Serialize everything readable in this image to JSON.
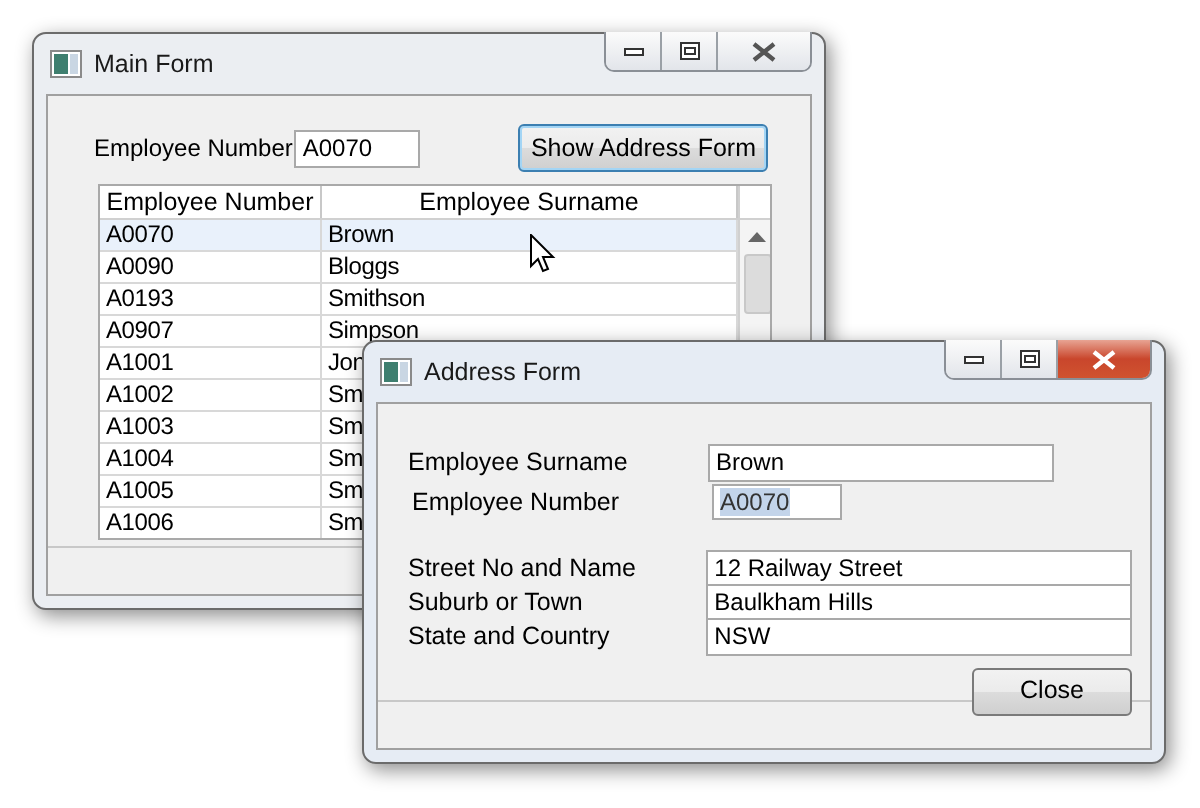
{
  "main_window": {
    "title": "Main Form",
    "active": false,
    "employee_number": {
      "label": "Employee Number",
      "value": "A0070"
    },
    "show_button": {
      "label": "Show Address Form",
      "focused": true
    },
    "grid": {
      "columns": [
        "Employee Number",
        "Employee Surname"
      ],
      "rows": [
        {
          "number": "A0070",
          "surname": "Brown",
          "selected": true
        },
        {
          "number": "A0090",
          "surname": "Bloggs",
          "selected": false
        },
        {
          "number": "A0193",
          "surname": "Smithson",
          "selected": false
        },
        {
          "number": "A0907",
          "surname": "Simpson",
          "selected": false
        },
        {
          "number": "A1001",
          "surname": "Jon",
          "selected": false
        },
        {
          "number": "A1002",
          "surname": "Sm",
          "selected": false
        },
        {
          "number": "A1003",
          "surname": "Sm",
          "selected": false
        },
        {
          "number": "A1004",
          "surname": "Sm",
          "selected": false
        },
        {
          "number": "A1005",
          "surname": "Sm",
          "selected": false
        },
        {
          "number": "A1006",
          "surname": "Sm",
          "selected": false
        }
      ]
    }
  },
  "address_window": {
    "title": "Address Form",
    "active": true,
    "fields": [
      {
        "label": "Employee Surname",
        "value": "Brown",
        "kind": "short",
        "text_selected": false
      },
      {
        "label": "Employee Number",
        "value": "A0070",
        "kind": "tiny",
        "text_selected": true
      },
      {
        "label": "Street No and Name",
        "value": "12 Railway Street",
        "kind": "wide",
        "text_selected": false
      },
      {
        "label": "Suburb or Town",
        "value": "Baulkham Hills",
        "kind": "wide",
        "text_selected": false
      },
      {
        "label": "State and Country",
        "value": "NSW",
        "kind": "wide",
        "text_selected": false
      }
    ],
    "close_button": {
      "label": "Close"
    }
  }
}
